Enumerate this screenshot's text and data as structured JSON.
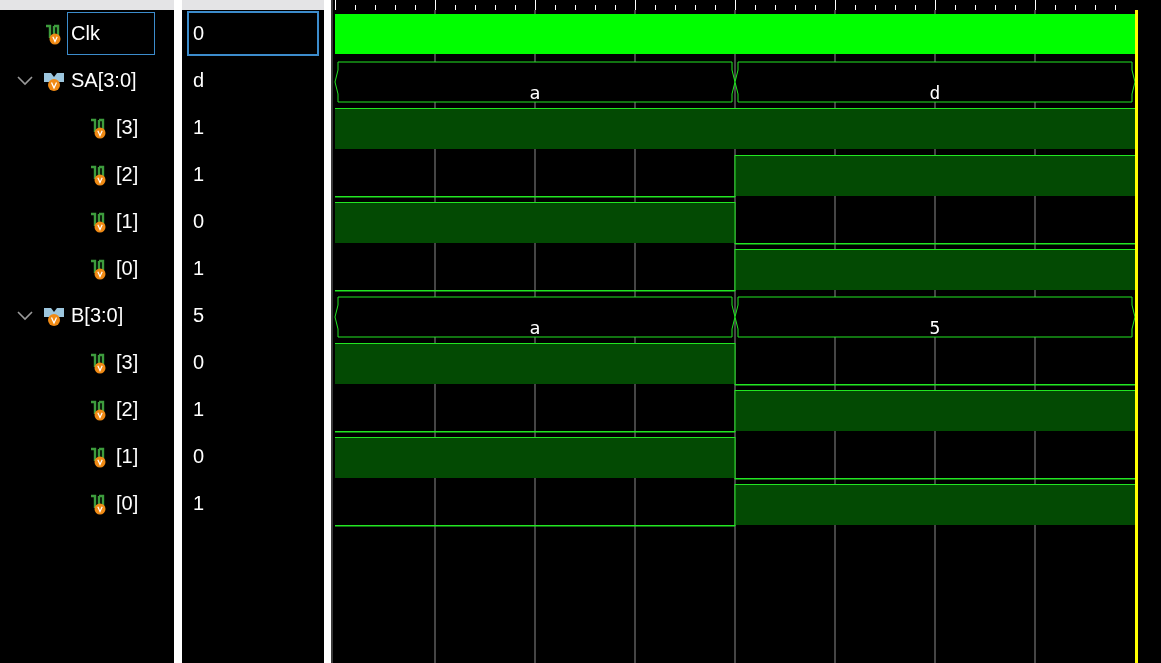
{
  "signals": [
    {
      "name": "Clk",
      "value": "0",
      "kind": "clock",
      "selected": true
    },
    {
      "name": "SA[3:0]",
      "value": "d",
      "kind": "bus",
      "selected": false,
      "expanded": true,
      "wave": [
        "a",
        "d"
      ],
      "children": [
        {
          "name": "[3]",
          "value": "1",
          "kind": "bit",
          "selected": false,
          "wave": [
            true,
            true
          ]
        },
        {
          "name": "[2]",
          "value": "1",
          "kind": "bit",
          "selected": false,
          "wave": [
            false,
            true
          ]
        },
        {
          "name": "[1]",
          "value": "0",
          "kind": "bit",
          "selected": false,
          "wave": [
            true,
            false
          ]
        },
        {
          "name": "[0]",
          "value": "1",
          "kind": "bit",
          "selected": false,
          "wave": [
            false,
            true
          ]
        }
      ]
    },
    {
      "name": "B[3:0]",
      "value": "5",
      "kind": "bus",
      "selected": false,
      "expanded": true,
      "wave": [
        "a",
        "5"
      ],
      "children": [
        {
          "name": "[3]",
          "value": "0",
          "kind": "bit",
          "selected": false,
          "wave": [
            true,
            false
          ]
        },
        {
          "name": "[2]",
          "value": "1",
          "kind": "bit",
          "selected": false,
          "wave": [
            false,
            true
          ]
        },
        {
          "name": "[1]",
          "value": "0",
          "kind": "bit",
          "selected": false,
          "wave": [
            true,
            false
          ]
        },
        {
          "name": "[0]",
          "value": "1",
          "kind": "bit",
          "selected": false,
          "wave": [
            false,
            true
          ]
        }
      ]
    }
  ]
}
